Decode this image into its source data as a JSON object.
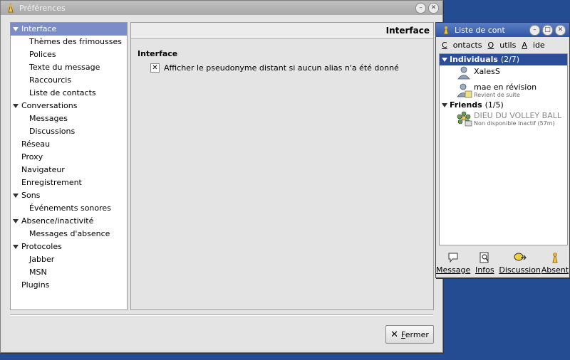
{
  "prefs": {
    "title": "Préférences",
    "tree": [
      {
        "label": "Interface",
        "level": 0,
        "expander": true,
        "selected": true
      },
      {
        "label": "Thèmes des frimousses",
        "level": 1
      },
      {
        "label": "Polices",
        "level": 1
      },
      {
        "label": "Texte du message",
        "level": 1
      },
      {
        "label": "Raccourcis",
        "level": 1
      },
      {
        "label": "Liste de contacts",
        "level": 1
      },
      {
        "label": "Conversations",
        "level": 0,
        "expander": true
      },
      {
        "label": "Messages",
        "level": 1
      },
      {
        "label": "Discussions",
        "level": 1
      },
      {
        "label": "Réseau",
        "level": 0
      },
      {
        "label": "Proxy",
        "level": 0
      },
      {
        "label": "Navigateur",
        "level": 0
      },
      {
        "label": "Enregistrement",
        "level": 0
      },
      {
        "label": "Sons",
        "level": 0,
        "expander": true
      },
      {
        "label": "Événements sonores",
        "level": 1
      },
      {
        "label": "Absence/inactivité",
        "level": 0,
        "expander": true
      },
      {
        "label": "Messages d'absence",
        "level": 1
      },
      {
        "label": "Protocoles",
        "level": 0,
        "expander": true
      },
      {
        "label": "Jabber",
        "level": 1
      },
      {
        "label": "MSN",
        "level": 1
      },
      {
        "label": "Plugins",
        "level": 0
      }
    ],
    "header": "Interface",
    "section_title": "Interface",
    "checkbox": {
      "mark": "✕",
      "label": "Afficher le pseudonyme distant si aucun alias n'a été donné",
      "checked": true
    },
    "close_button": {
      "icon": "✕",
      "mnemonic": "F",
      "rest": "ermer"
    }
  },
  "buddy": {
    "title": "Liste de cont",
    "menu": [
      {
        "m": "C",
        "r": "ontacts"
      },
      {
        "m": "O",
        "r": "utils"
      },
      {
        "m": "A",
        "r": "ide"
      }
    ],
    "groups": [
      {
        "name": "Individuals",
        "count": "(2/7)",
        "selected": true,
        "contacts": [
          {
            "name": "XalesS",
            "status": ""
          },
          {
            "name": "mae en révision",
            "status": "Revient de suite"
          }
        ]
      },
      {
        "name": "Friends",
        "count": "(1/5)",
        "contacts": [
          {
            "name": "DIEU DU VOLLEY BALL",
            "status": "Non disponible Inactif (57m)"
          }
        ]
      }
    ],
    "buttons": [
      {
        "label": "Message",
        "icon": "message-icon"
      },
      {
        "label": "Infos",
        "icon": "info-icon"
      },
      {
        "label": "Discussion",
        "icon": "chat-icon"
      },
      {
        "label": "Absent",
        "icon": "away-icon"
      }
    ]
  }
}
